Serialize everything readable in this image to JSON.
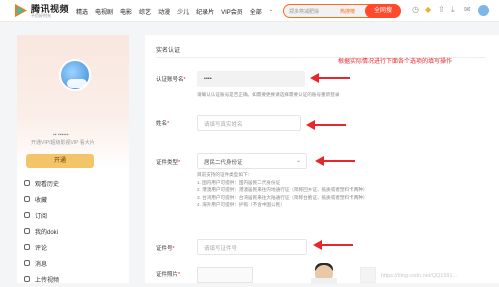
{
  "header": {
    "brand": "腾讯视频",
    "brand_sub": "不负好时光",
    "nav": [
      "精选",
      "电视剧",
      "电影",
      "综艺",
      "动漫",
      "少儿",
      "纪录片",
      "VIP会员",
      "全部"
    ],
    "nav_more": "⌄",
    "search_placeholder": "郑多燕减肥操",
    "search_hot": "热搜榜",
    "search_button": "全网搜"
  },
  "sidebar": {
    "username": "▪▪ ▪▪▪▪▪▪",
    "vip_note": "开通VIP/超级影视VIP 看大片",
    "open_button": "开通",
    "menu": [
      {
        "label": "观看历史",
        "icon": "history-icon"
      },
      {
        "label": "收藏",
        "icon": "star-icon"
      },
      {
        "label": "订阅",
        "icon": "subscribe-icon"
      },
      {
        "label": "我的doki",
        "icon": "doki-icon"
      },
      {
        "label": "评论",
        "icon": "comment-icon"
      },
      {
        "label": "消息",
        "icon": "message-icon"
      },
      {
        "label": "上传视频",
        "icon": "upload-icon"
      }
    ]
  },
  "main": {
    "title": "实名认证",
    "annotation": "根据实际情况进行下面各个选项的填写操作",
    "account_label": "认证账号名",
    "account_value": "▪▪▪▪",
    "account_hint": "请确认认证账号是否正确。如需要更换请选择需要认证的账号重新登录",
    "name_label": "姓名",
    "name_placeholder": "请填写真实姓名",
    "id_type_label": "证件类型",
    "id_type_value": "居民二代身份证",
    "id_type_hint": [
      "目前支持的证件类型如下：",
      "1. 国内用户可提供：国内居民二代身份证",
      "2. 港澳用户可提供：港澳居民来往内地通行证（简称回乡证，纸质或者塑料卡两种）",
      "3. 台湾用户可提供：台湾居民来往大陆通行证（简称台胞证，纸质或者塑料卡两种）",
      "4. 海外用户可提供：护照（不含中国公民）"
    ],
    "id_number_label": "证件号",
    "id_number_placeholder": "请填写证件号",
    "photo_label": "证件照片",
    "watermark": "https://blog.csdn.net/QQ1591..."
  },
  "colors": {
    "accent": "#ff4b2b",
    "annotation": "#e8272a",
    "vip_button": "#f3c568"
  }
}
